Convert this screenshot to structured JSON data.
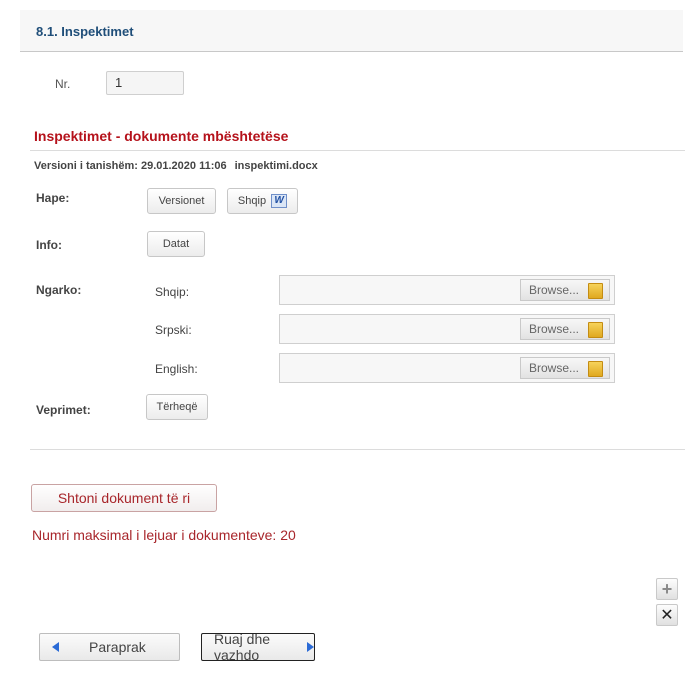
{
  "section": {
    "title": "8.1. Inspektimet"
  },
  "nr": {
    "label": "Nr.",
    "value": "1"
  },
  "documents": {
    "title": "Inspektimet - dokumente mbështetëse",
    "version_label": "Versioni i tanishëm: 29.01.2020 11:06",
    "file_name": "inspektimi.docx",
    "hape": {
      "label": "Hape:",
      "versions_button": "Versionet",
      "shqip_button": "Shqip",
      "word_icon": "W"
    },
    "info": {
      "label": "Info:",
      "dates_button": "Datat"
    },
    "upload": {
      "label": "Ngarko:",
      "browse_label": "Browse...",
      "languages": [
        "Shqip:",
        "Srpski:",
        "English:"
      ]
    },
    "actions": {
      "label": "Veprimet:",
      "withdraw_button": "Tërheqë"
    }
  },
  "add_document_button": "Shtoni dokument të ri",
  "max_documents_text": "Numri maksimal i lejuar i dokumenteve: 20",
  "icons": {
    "plus": "plus-icon",
    "remove": "x-icon",
    "folder": "folder-icon",
    "word": "word-icon"
  },
  "navigation": {
    "back_label": "Paraprak",
    "save_label": "Ruaj dhe vazhdo"
  },
  "colors": {
    "accent_red": "#b5121b",
    "title_blue": "#1f4e79",
    "nav_arrow_blue": "#2b6bd6"
  }
}
